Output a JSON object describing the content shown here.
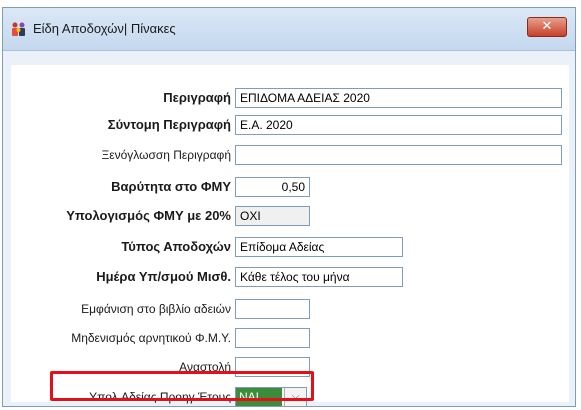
{
  "window": {
    "title": "Είδη Αποδοχών| Πίνακες",
    "close_glyph": "✕",
    "icon": "app-people-icon"
  },
  "form": {
    "description_label": "Περιγραφή",
    "description_value": "ΕΠΙΔΟΜΑ ΑΔΕΙΑΣ 2020",
    "short_description_label": "Σύντομη Περιγραφή",
    "short_description_value": "Ε.Α. 2020",
    "foreign_description_label": "Ξενόγλωσση Περιγραφή",
    "foreign_description_value": "",
    "fmy_weight_label": "Βαρύτητα στο ΦΜΥ",
    "fmy_weight_value": "0,50",
    "fmy_calc_label": "Υπολογισμός ΦΜΥ με 20%",
    "fmy_calc_value": "ΟΧΙ",
    "earnings_type_label": "Τύπος Αποδοχών",
    "earnings_type_value": "Επίδομα Αδείας",
    "payment_day_label": "Ημέρα Υπ/σμού Μισθ.",
    "payment_day_value": "Κάθε τέλος του μήνα",
    "leave_book_label": "Εμφάνιση στο βιβλίο αδειών",
    "leave_book_value": "",
    "zero_negative_label": "Μηδενισμός αρνητικού Φ.Μ.Υ.",
    "zero_negative_value": "",
    "suspension_label": "Αναστολή",
    "suspension_value": "",
    "prev_year_leave_label": "Υπολ.Αδείας Προηγ.Έτους",
    "prev_year_leave_value": "ΝΑΙ",
    "combo_arrow": "⌵"
  },
  "colors": {
    "highlight": "#e3101a",
    "selected_value_bg": "#3b8d3b",
    "close_button": "#c7402a"
  }
}
